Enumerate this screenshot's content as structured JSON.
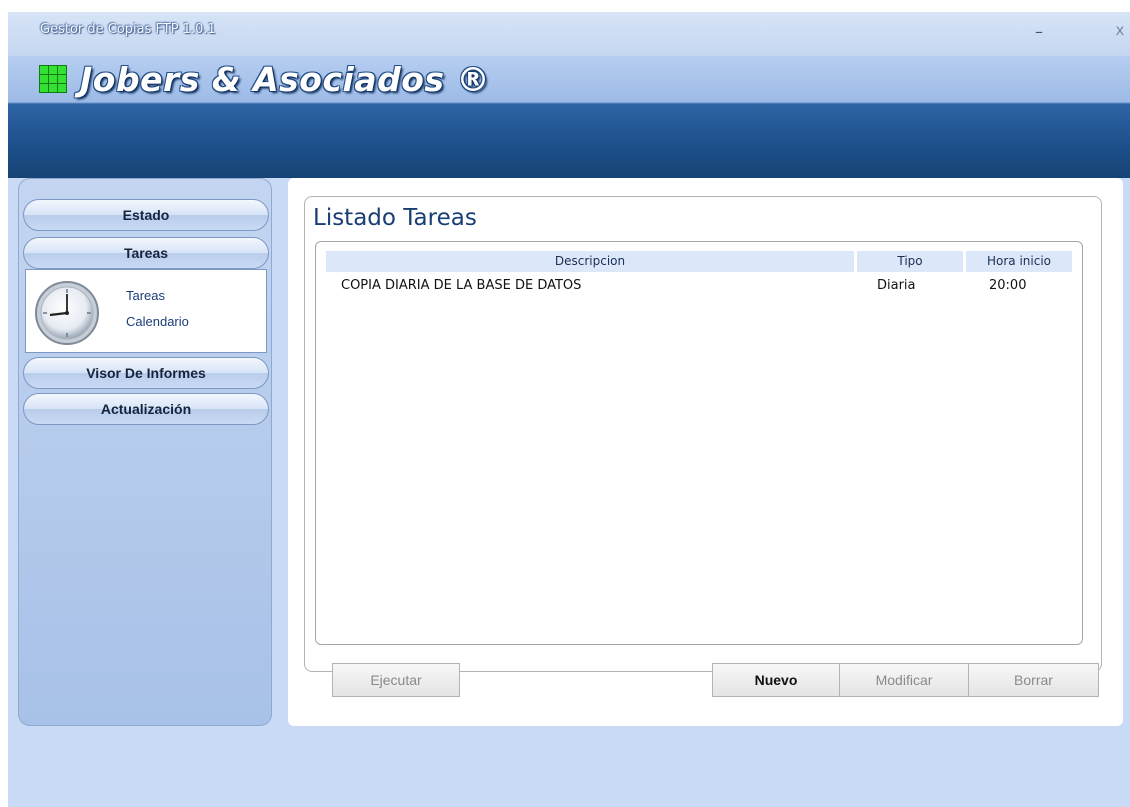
{
  "window": {
    "title": "Gestor de Copias FTP 1.0.1",
    "minimize_glyph": "–",
    "close_glyph": "x"
  },
  "banner": {
    "logo_icon": "green-grid-icon",
    "company": "Jobers & Asociados ®"
  },
  "sidebar": {
    "items": [
      {
        "label": "Estado"
      },
      {
        "label": "Tareas"
      },
      {
        "label": "Visor De Informes"
      },
      {
        "label": "Actualización"
      }
    ],
    "submenu": {
      "icon": "clock-icon",
      "links": [
        "Tareas",
        "Calendario"
      ]
    }
  },
  "main": {
    "title": "Listado Tareas",
    "table": {
      "columns": [
        "Descripcion",
        "Tipo",
        "Hora inicio"
      ],
      "rows": [
        [
          "COPIA DIARIA DE LA BASE DE DATOS",
          "Diaria",
          "20:00"
        ]
      ]
    },
    "buttons": {
      "run": "Ejecutar",
      "new": "Nuevo",
      "edit": "Modificar",
      "delete": "Borrar"
    }
  },
  "colors": {
    "accent_dark_blue": "#1d4f8b",
    "background": "#c9daf4",
    "logo_green": "#2fd12f"
  }
}
